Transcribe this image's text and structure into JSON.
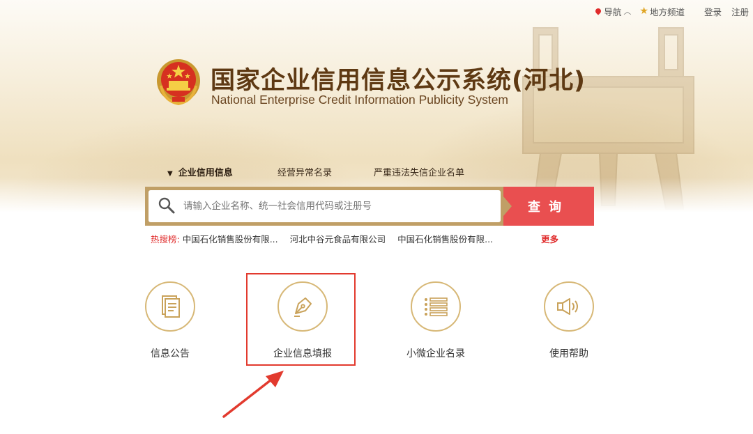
{
  "top_nav": {
    "navigation": "导航",
    "local_channel": "地方频道",
    "login": "登录",
    "register": "注册"
  },
  "header": {
    "title_cn": "国家企业信用信息公示系统(河北)",
    "title_en": "National Enterprise Credit Information Publicity System"
  },
  "search": {
    "tabs": [
      {
        "label": "企业信用信息",
        "active": true
      },
      {
        "label": "经营异常名录",
        "active": false
      },
      {
        "label": "严重违法失信企业名单",
        "active": false
      }
    ],
    "placeholder": "请输入企业名称、统一社会信用代码或注册号",
    "button": "查询"
  },
  "hot_search": {
    "label": "热搜榜:",
    "items": [
      "中国石化销售股份有限...",
      "河北中谷元食品有限公司",
      "中国石化销售股份有限..."
    ],
    "more": "更多"
  },
  "services": [
    {
      "label": "信息公告",
      "icon": "document-icon"
    },
    {
      "label": "企业信息填报",
      "icon": "pen-nib-icon",
      "highlighted": true
    },
    {
      "label": "小微企业名录",
      "icon": "list-icon"
    },
    {
      "label": "使用帮助",
      "icon": "speaker-icon"
    }
  ],
  "colors": {
    "brand_brown": "#5e3913",
    "gold": "#d7b877",
    "search_red": "#e94f50",
    "alert_red": "#e02b2b"
  }
}
